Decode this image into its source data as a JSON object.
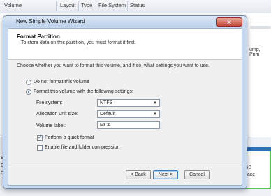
{
  "background": {
    "columns": [
      "Volume",
      "Layout",
      "Type",
      "File System",
      "Status"
    ],
    "right_text": "ump, Prim",
    "left_letters": [
      "E",
      "B",
      "C"
    ],
    "volume_text": [
      "GB",
      "pace"
    ]
  },
  "dialog": {
    "title": "New Simple Volume Wizard",
    "close_label": "✕",
    "header_title": "Format Partition",
    "header_subtitle": "To store data on this partition, you must format it first.",
    "instruction": "Choose whether you want to format this volume, and if so, what settings you want to use.",
    "options": {
      "no_format": "Do not format this volume",
      "format": "Format this volume with the following settings:",
      "selected": "format"
    },
    "fields": {
      "file_system_label": "File system:",
      "file_system_value": "NTFS",
      "alloc_label": "Allocation unit size:",
      "alloc_value": "Default",
      "volume_label_label": "Volume label:",
      "volume_label_value": "MCA"
    },
    "checkboxes": {
      "quick_format_label": "Perform a quick format",
      "quick_format_checked": true,
      "compression_label": "Enable file and folder compression",
      "compression_checked": false
    },
    "buttons": {
      "back": "< Back",
      "next": "Next >",
      "cancel": "Cancel"
    }
  }
}
